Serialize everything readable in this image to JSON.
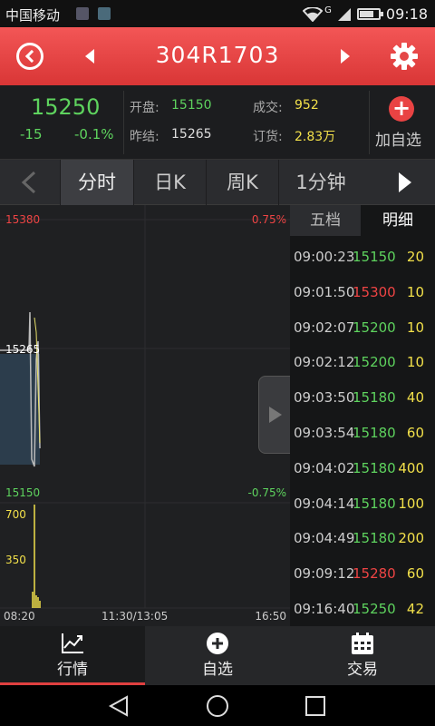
{
  "status_bar": {
    "carrier": "中国移动",
    "time": "09:18",
    "network": "G"
  },
  "title_bar": {
    "title": "304R1703"
  },
  "quote": {
    "price": "15250",
    "change": "-15",
    "change_pct": "-0.1%",
    "open_label": "开盘:",
    "open_value": "15150",
    "prev_label": "昨结:",
    "prev_value": "15265",
    "volume_label": "成交:",
    "volume_value": "952",
    "order_label": "订货:",
    "order_value": "2.83万",
    "add_watch_label": "加自选"
  },
  "tabs": [
    {
      "label": "分时",
      "active": true
    },
    {
      "label": "日K",
      "active": false
    },
    {
      "label": "周K",
      "active": false
    },
    {
      "label": "1分钟",
      "active": false
    }
  ],
  "chart": {
    "price_high": "15380",
    "price_high_pct": "0.75%",
    "price_ref": "15265",
    "price_low": "15150",
    "price_low_pct": "-0.75%",
    "volume_high": "700",
    "volume_mid": "350",
    "time_start": "08:20",
    "time_mid": "11:30/13:05",
    "time_end": "16:50"
  },
  "detail_panel": {
    "tab_five": "五档",
    "tab_detail": "明细",
    "rows": [
      {
        "time": "09:00:23",
        "price": "15150",
        "volume": "20",
        "color": "#5ed35e"
      },
      {
        "time": "09:01:50",
        "price": "15300",
        "volume": "10",
        "color": "#ee4444"
      },
      {
        "time": "09:02:07",
        "price": "15200",
        "volume": "10",
        "color": "#5ed35e"
      },
      {
        "time": "09:02:12",
        "price": "15200",
        "volume": "10",
        "color": "#5ed35e"
      },
      {
        "time": "09:03:50",
        "price": "15180",
        "volume": "40",
        "color": "#5ed35e"
      },
      {
        "time": "09:03:54",
        "price": "15180",
        "volume": "60",
        "color": "#5ed35e"
      },
      {
        "time": "09:04:02",
        "price": "15180",
        "volume": "400",
        "color": "#5ed35e"
      },
      {
        "time": "09:04:14",
        "price": "15180",
        "volume": "100",
        "color": "#5ed35e"
      },
      {
        "time": "09:04:49",
        "price": "15180",
        "volume": "200",
        "color": "#5ed35e"
      },
      {
        "time": "09:09:12",
        "price": "15280",
        "volume": "60",
        "color": "#ee4444"
      },
      {
        "time": "09:16:40",
        "price": "15250",
        "volume": "42",
        "color": "#5ed35e"
      }
    ]
  },
  "bottom_nav": [
    {
      "label": "行情",
      "icon": "chart-icon",
      "active": true
    },
    {
      "label": "自选",
      "icon": "add-circle-icon",
      "active": false
    },
    {
      "label": "交易",
      "icon": "calendar-icon",
      "active": false
    }
  ],
  "colors": {
    "up": "#ee4444",
    "down": "#5ed35e",
    "accent": "#e94343",
    "volume": "#f2e04a"
  }
}
